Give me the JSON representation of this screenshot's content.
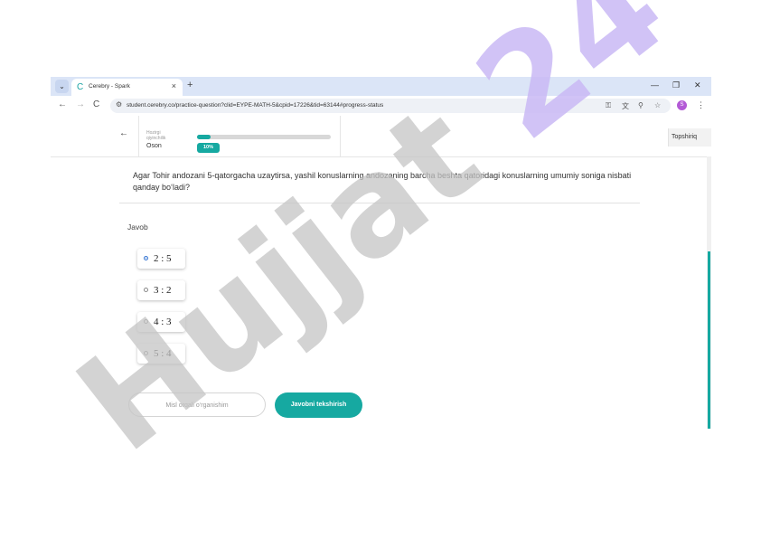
{
  "browser": {
    "tab_menu_icon": "chevron-down-icon",
    "tab_title": "Cerebry - Spark",
    "tab_close": "×",
    "new_tab": "+",
    "controls": {
      "minimize": "—",
      "restore": "❐",
      "close": "✕"
    },
    "url": "student.cerebry.co/practice-question?clid=EYPE-MATH-5&cpid=17226&tid=63144#progress-status",
    "nav": {
      "back": "←",
      "forward": "→",
      "reload": "C"
    },
    "profile_initial": "S"
  },
  "header": {
    "back": "←",
    "difficulty_caption": "Hozirgi\nqiyinchilik",
    "difficulty_value": "Oson",
    "progress_percent": 10,
    "progress_label": "10%",
    "task_button": "Topshiriq"
  },
  "question": {
    "text": "Agar Tohir andozani  5-qatorgacha uzaytirsa, yashil konuslarning andozaning barcha beshta qatoridagi konuslarning umumiy soniga nisbati qanday bo‘ladi?"
  },
  "answer": {
    "label": "Javob",
    "options": [
      {
        "text": "2 : 5",
        "selected": true
      },
      {
        "text": "3 : 2",
        "selected": false
      },
      {
        "text": "4 : 3",
        "selected": false
      },
      {
        "text": "5 : 4",
        "selected": false
      }
    ]
  },
  "actions": {
    "hint": "Misl orqali o‘rganishim",
    "check": "Javobni tekshirish"
  },
  "watermark": {
    "text": "Hujjat 24",
    "colors": {
      "text": "#c4c4c4",
      "number": "#c9b8f5"
    }
  },
  "colors": {
    "accent": "#16a9a1",
    "radio_selected": "#3a78d4",
    "tabstrip": "#dbe5f7"
  }
}
